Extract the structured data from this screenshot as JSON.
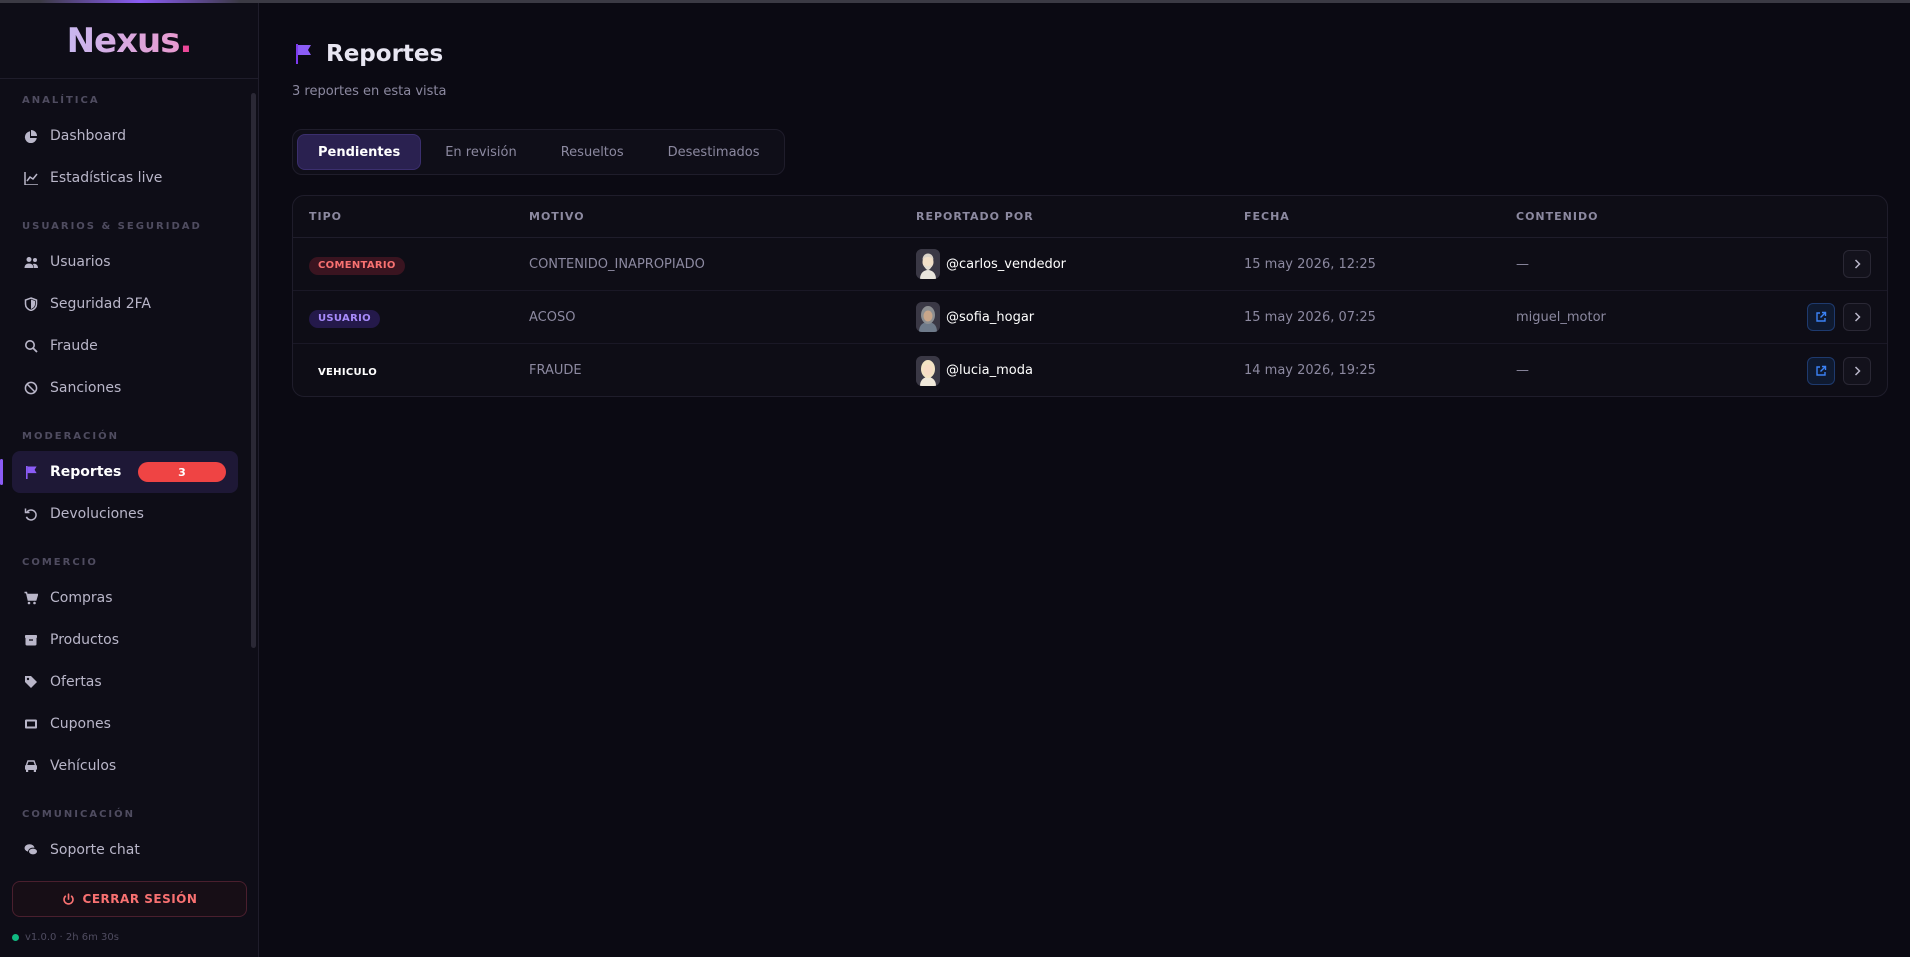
{
  "brand": {
    "name": "Nexus",
    "dot": "."
  },
  "sidebar": {
    "sections": [
      {
        "label": "ANALÍTICA",
        "items": [
          {
            "label": "Dashboard",
            "icon": "pie-chart-icon"
          },
          {
            "label": "Estadísticas live",
            "icon": "line-chart-icon"
          }
        ]
      },
      {
        "label": "USUARIOS & SEGURIDAD",
        "items": [
          {
            "label": "Usuarios",
            "icon": "users-icon"
          },
          {
            "label": "Seguridad 2FA",
            "icon": "shield-icon"
          },
          {
            "label": "Fraude",
            "icon": "search-icon"
          },
          {
            "label": "Sanciones",
            "icon": "ban-icon"
          }
        ]
      },
      {
        "label": "MODERACIÓN",
        "items": [
          {
            "label": "Reportes",
            "icon": "flag-icon",
            "active": true,
            "badge": "3"
          },
          {
            "label": "Devoluciones",
            "icon": "undo-icon"
          }
        ]
      },
      {
        "label": "COMERCIO",
        "items": [
          {
            "label": "Compras",
            "icon": "cart-icon"
          },
          {
            "label": "Productos",
            "icon": "box-icon"
          },
          {
            "label": "Ofertas",
            "icon": "tag-icon"
          },
          {
            "label": "Cupones",
            "icon": "ticket-icon"
          },
          {
            "label": "Vehículos",
            "icon": "car-icon"
          }
        ]
      },
      {
        "label": "COMUNICACIÓN",
        "items": [
          {
            "label": "Soporte chat",
            "icon": "chat-icon"
          }
        ]
      }
    ],
    "logout_label": "CERRAR SESIÓN",
    "version": "v1.0.0 · 2h 6m 30s"
  },
  "page": {
    "title": "Reportes",
    "subtitle": "3 reportes en esta vista",
    "tabs": [
      {
        "label": "Pendientes",
        "active": true
      },
      {
        "label": "En revisión"
      },
      {
        "label": "Resueltos"
      },
      {
        "label": "Desestimados"
      }
    ]
  },
  "table": {
    "headers": [
      "TIPO",
      "MOTIVO",
      "REPORTADO POR",
      "FECHA",
      "CONTENIDO"
    ],
    "rows": [
      {
        "tipo": "COMENTARIO",
        "tipo_style": "red",
        "motivo": "CONTENIDO_INAPROPIADO",
        "reporter": "@carlos_vendedor",
        "fecha": "15 may 2026, 12:25",
        "contenido": "—",
        "has_link": false
      },
      {
        "tipo": "USUARIO",
        "tipo_style": "purple",
        "motivo": "ACOSO",
        "reporter": "@sofia_hogar",
        "fecha": "15 may 2026, 07:25",
        "contenido": "miguel_motor",
        "has_link": true
      },
      {
        "tipo": "VEHICULO",
        "tipo_style": "plain",
        "motivo": "FRAUDE",
        "reporter": "@lucia_moda",
        "fecha": "14 may 2026, 19:25",
        "contenido": "—",
        "has_link": true
      }
    ]
  },
  "colors": {
    "accent": "#8b5cf6",
    "badge": "#ef4444",
    "status_online": "#10b981"
  }
}
